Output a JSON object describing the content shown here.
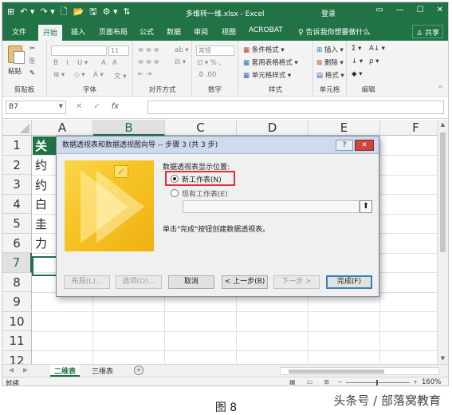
{
  "window": {
    "title": "多维转一维.xlsx - Excel",
    "login_label": "登录",
    "controls": [
      "▭",
      "—",
      "☐",
      "✕"
    ]
  },
  "quick_access": [
    "⊞",
    "↶ ▾",
    "↷ ▾",
    "🗋",
    "📂",
    "🖫",
    "⚙ ▾",
    "⇅"
  ],
  "tabs": [
    "文件",
    "开始",
    "插入",
    "页面布局",
    "公式",
    "数据",
    "审阅",
    "视图",
    "ACROBAT"
  ],
  "active_tab": "开始",
  "tell_me": "♀ 告诉我你想要做什么",
  "share_label": "♙ 共享",
  "ribbon": {
    "groups": [
      "剪贴板",
      "字体",
      "对齐方式",
      "数字",
      "样式",
      "单元格",
      "编辑"
    ],
    "font_name": "",
    "font_size": "11",
    "number_format": "常规",
    "styles": [
      "条件格式 ▾",
      "套用表格格式 ▾",
      "单元格样式 ▾"
    ],
    "cells": [
      "插入 ▾",
      "删除 ▾",
      "格式 ▾"
    ],
    "font_buttons": [
      "B",
      "I",
      "U ▾",
      "A",
      "A"
    ],
    "editing": [
      "Σ ▾",
      "A↓ ▾",
      "↓ ▾",
      "ρ ▾",
      "◆ ▾"
    ],
    "paste_label": "粘贴"
  },
  "formula_bar": {
    "name_box": "B7",
    "fx": "fx",
    "formula": ""
  },
  "columns": [
    "A",
    "B",
    "C",
    "D",
    "E",
    "F"
  ],
  "rows": [
    "1",
    "2",
    "3",
    "4",
    "5",
    "6",
    "7",
    "8",
    "9",
    "10",
    "11",
    "12"
  ],
  "cells": {
    "A1": "关",
    "A2": "约",
    "A3": "约",
    "A4": "白",
    "A5": "圭",
    "A6": "力"
  },
  "dialog": {
    "title": "数据透视表和数据透视图向导 -- 步骤 3 (共 3 步)",
    "help": "?",
    "close": "✕",
    "section_label": "数据透视表显示位置:",
    "option_new": "新工作表(N)",
    "option_existing": "现有工作表(E)",
    "hint": "单击\"完成\"按钮创建数据透视表。",
    "range_value": "",
    "range_button": "⬆",
    "buttons": {
      "layout": "布局(L)...",
      "options": "选项(O)...",
      "cancel": "取消",
      "back": "< 上一步(B)",
      "next": "下一步 >",
      "finish": "完成(F)"
    }
  },
  "sheets": [
    "二维表",
    "三维表"
  ],
  "active_sheet": "二维表",
  "status": {
    "ready": "就绪",
    "zoom": "160%"
  },
  "caption": "图 8",
  "watermark": "头条号 / 部落窝教育"
}
